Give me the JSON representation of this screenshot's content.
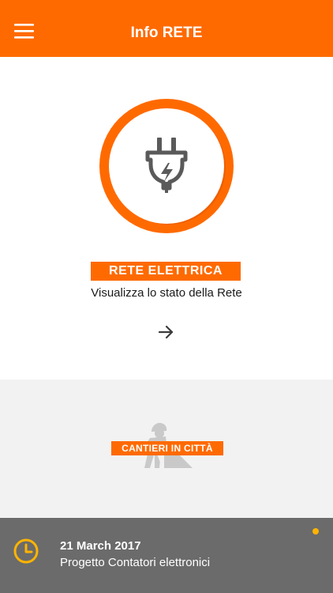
{
  "header": {
    "title": "Info RETE",
    "menu_icon": "hamburger-menu-icon"
  },
  "rete": {
    "icon": "electric-plug-icon",
    "label": "RETE ELETTRICA",
    "subtitle": "Visualizza lo stato della Rete",
    "arrow_icon": "arrow-right-icon"
  },
  "cantieri": {
    "icon": "road-worker-icon",
    "label": "CANTIERI IN CITTÀ"
  },
  "news": {
    "icon": "clock-icon",
    "date": "21 March 2017",
    "title": "Progetto Contatori elettronici"
  },
  "colors": {
    "accent": "#ff6a00",
    "news_background": "#6b6b6b",
    "clock": "#ffb400",
    "cantieri_background": "#f2f2f2"
  }
}
